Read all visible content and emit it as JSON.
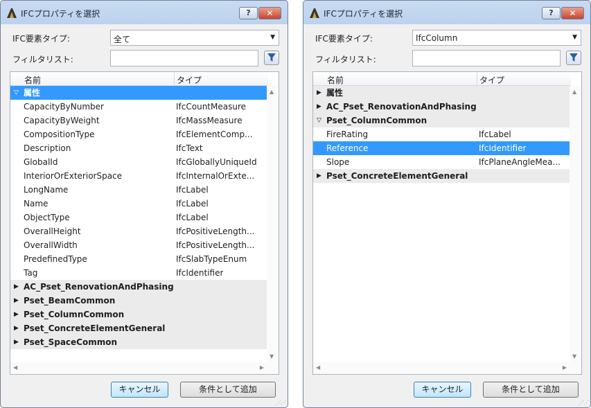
{
  "dialogs": [
    {
      "title": "IFCプロパティを選択",
      "help_label": "?",
      "close_label": "✕",
      "type_label": "IFC要素タイプ:",
      "type_value": "全て",
      "filter_label": "フィルタリスト:",
      "filter_value": "",
      "col_name": "名前",
      "col_type": "タイプ",
      "groups": [
        {
          "name": "属性",
          "expanded": true,
          "selected": true,
          "items": [
            {
              "name": "CapacityByNumber",
              "type": "IfcCountMeasure"
            },
            {
              "name": "CapacityByWeight",
              "type": "IfcMassMeasure"
            },
            {
              "name": "CompositionType",
              "type": "IfcElementComp..."
            },
            {
              "name": "Description",
              "type": "IfcText"
            },
            {
              "name": "GlobalId",
              "type": "IfcGloballyUniqueId"
            },
            {
              "name": "InteriorOrExteriorSpace",
              "type": "IfcInternalOrExte..."
            },
            {
              "name": "LongName",
              "type": "IfcLabel"
            },
            {
              "name": "Name",
              "type": "IfcLabel"
            },
            {
              "name": "ObjectType",
              "type": "IfcLabel"
            },
            {
              "name": "OverallHeight",
              "type": "IfcPositiveLength..."
            },
            {
              "name": "OverallWidth",
              "type": "IfcPositiveLength..."
            },
            {
              "name": "PredefinedType",
              "type": "IfcSlabTypeEnum"
            },
            {
              "name": "Tag",
              "type": "IfcIdentifier"
            }
          ]
        },
        {
          "name": "AC_Pset_RenovationAndPhasing",
          "expanded": false,
          "items": []
        },
        {
          "name": "Pset_BeamCommon",
          "expanded": false,
          "items": []
        },
        {
          "name": "Pset_ColumnCommon",
          "expanded": false,
          "items": []
        },
        {
          "name": "Pset_ConcreteElementGeneral",
          "expanded": false,
          "items": []
        },
        {
          "name": "Pset_SpaceCommon",
          "expanded": false,
          "items": []
        }
      ],
      "cancel_label": "キャンセル",
      "add_label": "条件として追加"
    },
    {
      "title": "IFCプロパティを選択",
      "help_label": "?",
      "close_label": "✕",
      "type_label": "IFC要素タイプ:",
      "type_value": "IfcColumn",
      "filter_label": "フィルタリスト:",
      "filter_value": "",
      "col_name": "名前",
      "col_type": "タイプ",
      "groups": [
        {
          "name": "属性",
          "expanded": false,
          "items": []
        },
        {
          "name": "AC_Pset_RenovationAndPhasing",
          "expanded": false,
          "items": []
        },
        {
          "name": "Pset_ColumnCommon",
          "expanded": true,
          "items": [
            {
              "name": "FireRating",
              "type": "IfcLabel"
            },
            {
              "name": "Reference",
              "type": "IfcIdentifier",
              "selected": true
            },
            {
              "name": "Slope",
              "type": "IfcPlaneAngleMea..."
            }
          ]
        },
        {
          "name": "Pset_ConcreteElementGeneral",
          "expanded": false,
          "items": []
        }
      ],
      "cancel_label": "キャンセル",
      "add_label": "条件として追加"
    }
  ],
  "colors": {
    "selection": "#3399ff",
    "title_bg": "#bcd2ee",
    "close": "#c8452e"
  },
  "icons": {
    "expanded": "▽",
    "collapsed": "▶",
    "dropdown": "▼",
    "filter": "filter-icon"
  }
}
